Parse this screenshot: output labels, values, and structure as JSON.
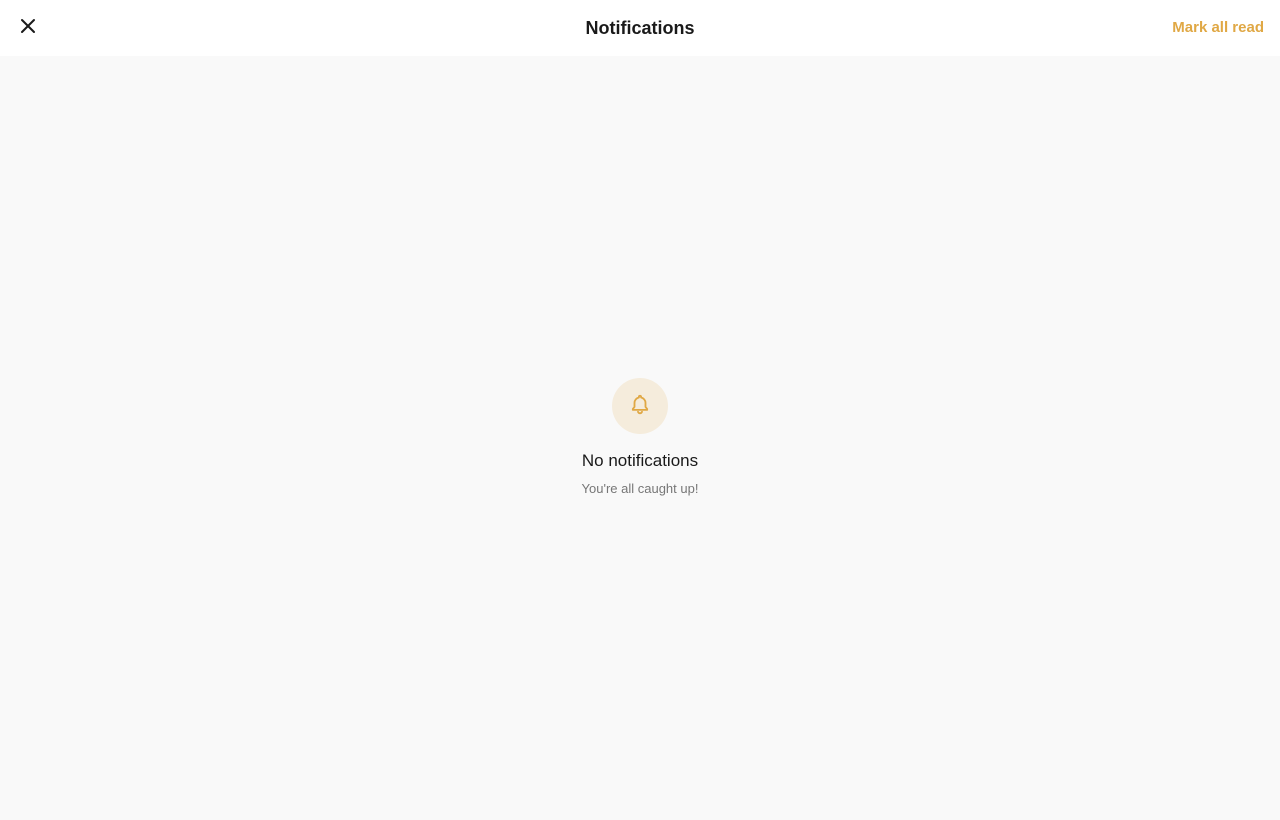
{
  "header": {
    "title": "Notifications",
    "mark_all_read_label": "Mark all read",
    "close_icon": "close-icon"
  },
  "empty_state": {
    "icon": "bell-icon",
    "title": "No notifications",
    "subtitle": "You're all caught up!"
  },
  "colors": {
    "accent": "#e0a845",
    "icon_bg": "#f5ecdc",
    "page_bg": "#f9f9f9",
    "header_bg": "#ffffff"
  }
}
